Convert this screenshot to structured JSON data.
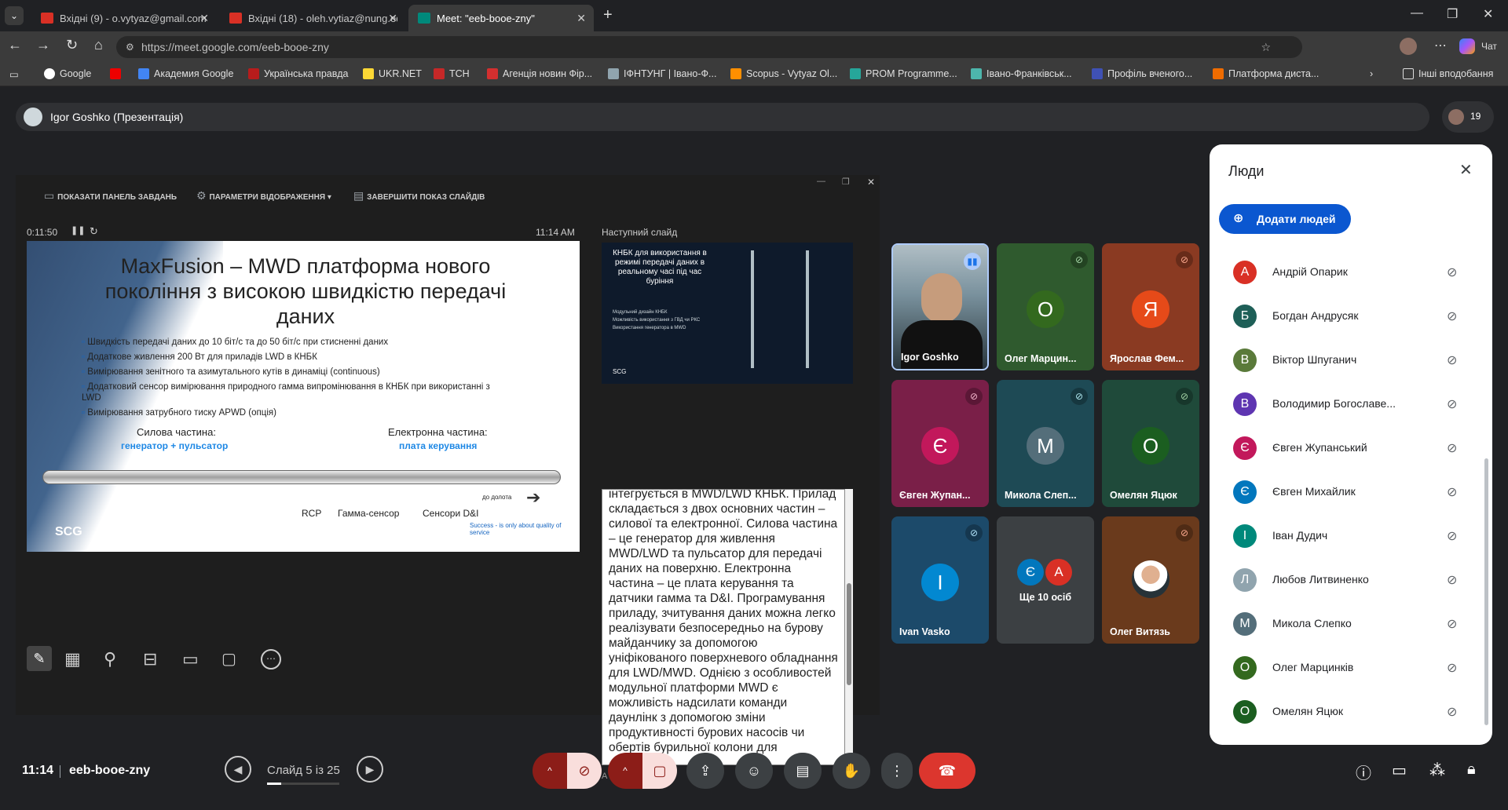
{
  "browser": {
    "tabs": [
      {
        "label": "Вхідні (9) - o.vytyaz@gmail.com - ",
        "icon_color": "#d93025"
      },
      {
        "label": "Вхідні (18) - oleh.vytiaz@nung.edu",
        "icon_color": "#d93025"
      },
      {
        "label": "Meet: \"eeb-booe-zny\"",
        "icon_color": "#00897b"
      }
    ],
    "url": "https://meet.google.com/eeb-booe-zny",
    "right_label": "Чат",
    "bookmarks": [
      "Google",
      "Академия Google",
      "Українська правда",
      "UKR.NET",
      "ТСН",
      "Агенція новин Фір...",
      "ІФНТУНГ | Івано-Ф...",
      "Scopus - Vytyaz Ol...",
      "PROM Programme...",
      "Івано-Франківськ...",
      "Профіль вченого...",
      "Платформа диста...",
      "Інші вподобання"
    ]
  },
  "meet": {
    "presenter_label": "Igor Goshko (Презентація)",
    "participants_count": "19",
    "presentation": {
      "top_menu": [
        "ПОКАЗАТИ ПАНЕЛЬ ЗАВДАНЬ",
        "ПАРАМЕТРИ ВІДОБРАЖЕННЯ ▾",
        "ЗАВЕРШИТИ ПОКАЗ СЛАЙДІВ"
      ],
      "timer": "0:11:50",
      "clock": "11:14 AM",
      "next_slide_label": "Наступний слайд",
      "slide_counter": "Слайд 5 із 25",
      "slide": {
        "title": "MaxFusion – MWD платформа нового покоління з високою швидкістю передачі даних",
        "bullets": [
          "Швидкість передачі даних до 10 біт/с та до 50 біт/с при стисненні даних",
          "Додаткове живлення 200 Вт для приладів LWD в КНБК",
          "Вимірювання зенітного та азимутального кутів в динаміці (continuous)",
          "Додатковий сенсор вимірювання природного гамма випромінювання в КНБК при використанні з LWD",
          "Вимірювання затрубного тиску APWD (опція)"
        ],
        "power_label": "Силова частина:",
        "power_sub": "генератор + пульсатор",
        "elec_label": "Електронна частина:",
        "elec_sub": "плата керування",
        "tool_labels": [
          "RCP",
          "Гамма-сенсор",
          "Сенсори D&I",
          "до долота"
        ],
        "logo": "SCG",
        "slogan": "Success - is only about quality of service"
      },
      "next_slide": {
        "title": "КНБК для використання в режимі передачі даних в реальному часі під час буріння",
        "bullets": [
          "Модульний дизайн КНБК",
          "Можливість використання з ГВД чи РКС",
          "Використання генератора в MWD"
        ],
        "logo": "SCG"
      },
      "notes": "інтегрується в MWD/LWD КНБК. Прилад складається з двох основних частин – силової та електронної. Силова частина – це генератор для живлення MWD/LWD та пульсатор для передачі даних на поверхню. Електронна частина – це плата керування та датчики гамма та D&I. Програмування приладу, зчитування даних можна легко реалізувати безпосередньо на бурову майданчику за допомогою уніфікованого поверхневого обладнання для LWD/MWD. Однією з особливостей модульної платформи MWD є можливість надсилати команди даунлінк з допомогою зміни продуктивності бурових насосів чи обертів бурильної колони для"
    },
    "tiles": [
      {
        "name": "Igor Goshko",
        "initial": "",
        "bg": "#3c4043",
        "avatar_color": "#000000",
        "speaking": true
      },
      {
        "name": "Олег Марцин...",
        "initial": "О",
        "bg": "#2f5a2e",
        "avatar_color": "#33691e",
        "speaking": false
      },
      {
        "name": "Ярослав Фем...",
        "initial": "Я",
        "bg": "#8a3a22",
        "avatar_color": "#e64a19",
        "speaking": false
      },
      {
        "name": "Євген Жупан...",
        "initial": "Є",
        "bg": "#7a1f48",
        "avatar_color": "#c2185b",
        "speaking": false
      },
      {
        "name": "Микола Слеп...",
        "initial": "М",
        "bg": "#1e4a55",
        "avatar_color": "#546e7a",
        "speaking": false
      },
      {
        "name": "Омелян Яцюк",
        "initial": "О",
        "bg": "#1f4a3a",
        "avatar_color": "#1b5e20",
        "speaking": false
      },
      {
        "name": "Ivan Vasko",
        "initial": "I",
        "bg": "#1c4a6a",
        "avatar_color": "#0288d1",
        "speaking": false
      },
      {
        "name": "Ще 10 осіб",
        "initial": "",
        "bg": "#3c4043",
        "avatar_color": "#3c4043",
        "speaking": false
      },
      {
        "name": "Олег Витязь",
        "initial": "",
        "bg": "#6a3a1c",
        "avatar_color": "#ffffff",
        "speaking": false
      }
    ],
    "more_avatars": [
      "Є",
      "А"
    ],
    "people_panel": {
      "title": "Люди",
      "add_button": "Додати людей",
      "people": [
        {
          "name": "Андрій Опарик",
          "initial": "А",
          "color": "#d93025"
        },
        {
          "name": "Богдан Андрусяк",
          "initial": "Б",
          "color": "#1e5f57"
        },
        {
          "name": "Віктор Шпуганич",
          "initial": "В",
          "color": "#5a7a3a"
        },
        {
          "name": "Володимир Богославе...",
          "initial": "В",
          "color": "#5e35b1"
        },
        {
          "name": "Євген Жупанський",
          "initial": "Є",
          "color": "#c2185b"
        },
        {
          "name": "Євген Михайлик",
          "initial": "Є",
          "color": "#0277bd"
        },
        {
          "name": "Іван Дудич",
          "initial": "І",
          "color": "#00897b"
        },
        {
          "name": "Любов Литвиненко",
          "initial": "Л",
          "color": "#90a4ae"
        },
        {
          "name": "Микола Слепко",
          "initial": "М",
          "color": "#546e7a"
        },
        {
          "name": "Олег Марцинків",
          "initial": "О",
          "color": "#33691e"
        },
        {
          "name": "Омелян Яцюк",
          "initial": "О",
          "color": "#1b5e20"
        }
      ]
    },
    "bottom": {
      "time": "11:14",
      "meeting_code": "eeb-booe-zny"
    }
  }
}
